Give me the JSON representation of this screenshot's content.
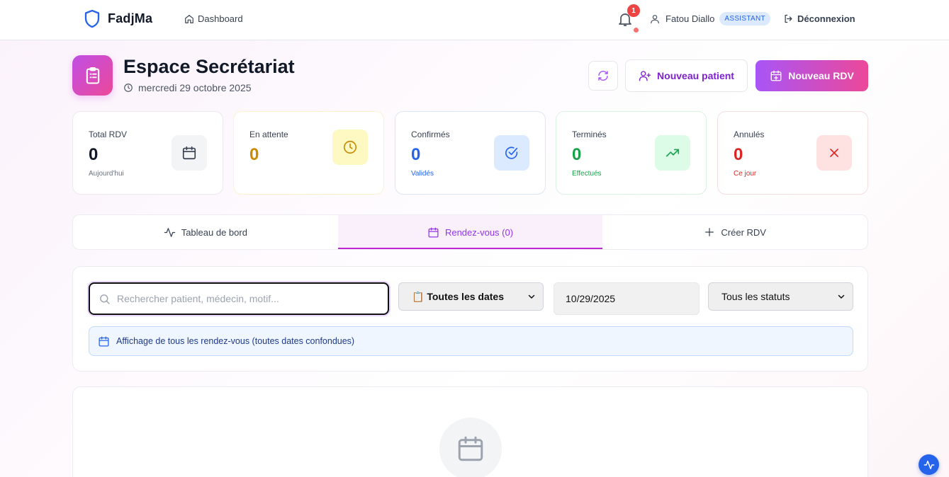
{
  "nav": {
    "brand": "FadjMa",
    "dashboard_link": "Dashboard",
    "notifications_count": "1",
    "user_name": "Fatou Diallo",
    "user_role": "ASSISTANT",
    "logout_label": "Déconnexion"
  },
  "header": {
    "title": "Espace Secrétariat",
    "date": "mercredi 29 octobre 2025",
    "new_patient_label": "Nouveau patient",
    "new_rdv_label": "Nouveau RDV"
  },
  "stats": [
    {
      "label": "Total RDV",
      "value": "0",
      "sub": "Aujourd'hui",
      "color": "#111827",
      "sub_color": "#6b7280",
      "icon": "calendar-icon",
      "icon_bg": "#f3f4f6",
      "icon_color": "#374151",
      "border": "#e9e9ef"
    },
    {
      "label": "En attente",
      "value": "0",
      "sub": "",
      "color": "#ca8a04",
      "sub_color": "#ca8a04",
      "icon": "clock-icon",
      "icon_bg": "#fef9c3",
      "icon_color": "#ca8a04",
      "border": "#fbf3d0"
    },
    {
      "label": "Confirmés",
      "value": "0",
      "sub": "Validés",
      "color": "#2563eb",
      "sub_color": "#2563eb",
      "icon": "check-circle-icon",
      "icon_bg": "#dbeafe",
      "icon_color": "#2563eb",
      "border": "#dbe6f7"
    },
    {
      "label": "Terminés",
      "value": "0",
      "sub": "Effectués",
      "color": "#16a34a",
      "sub_color": "#16a34a",
      "icon": "trend-up-icon",
      "icon_bg": "#dcfce7",
      "icon_color": "#16a34a",
      "border": "#d9f2e2"
    },
    {
      "label": "Annulés",
      "value": "0",
      "sub": "Ce jour",
      "color": "#dc2626",
      "sub_color": "#dc2626",
      "icon": "x-icon",
      "icon_bg": "#fee2e2",
      "icon_color": "#dc2626",
      "border": "#f7dede"
    }
  ],
  "tabs": [
    {
      "label": "Tableau de bord",
      "icon": "activity-icon"
    },
    {
      "label": "Rendez-vous (0)",
      "icon": "calendar-icon"
    },
    {
      "label": "Créer RDV",
      "icon": "plus-icon"
    }
  ],
  "filters": {
    "search_placeholder": "Rechercher patient, médecin, motif...",
    "date_filter": "📋 Toutes les dates",
    "date_value": "10/29/2025",
    "status_filter": "Tous les statuts",
    "info_text": "Affichage de tous les rendez-vous (toutes dates confondues)"
  },
  "accent": "#a855f7"
}
